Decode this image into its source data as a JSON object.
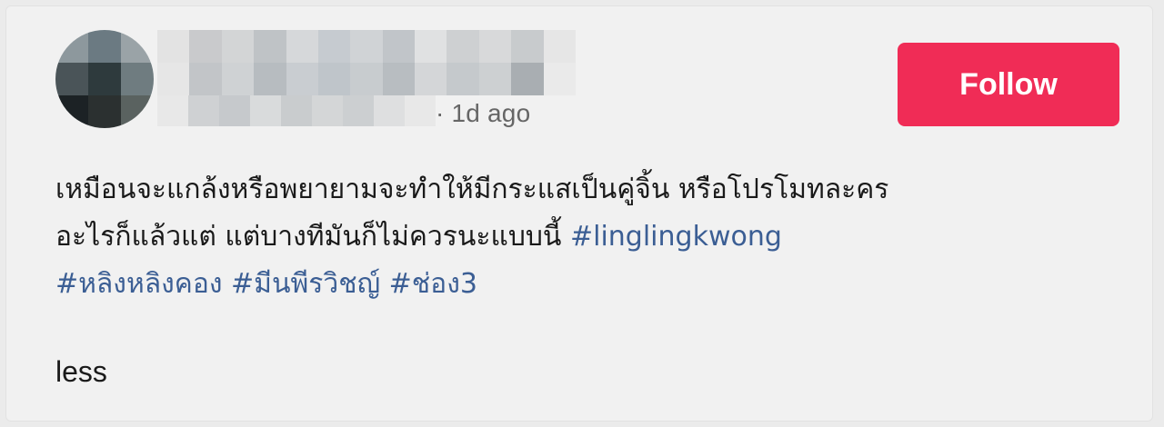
{
  "post": {
    "time": "· 1d ago",
    "follow_label": "Follow",
    "caption_line1": "เหมือนจะแกล้งหรือพยายามจะทำให้มีกระแสเป็นคู่จิ้น หรือโปรโมทละคร",
    "caption_line2_text": "อะไรก็แล้วแต่ แต่บางทีมันก็ไม่ควรนะแบบนี้ ",
    "hashtags": [
      "#linglingkwong",
      "#หลิงหลิงคอง",
      "#มีนพีรวิชญ์",
      "#ช่อง3"
    ],
    "less_label": "less"
  },
  "colors": {
    "follow_bg": "#f02c56",
    "hashtag": "#3b5e94",
    "background": "#f1f1f1"
  }
}
